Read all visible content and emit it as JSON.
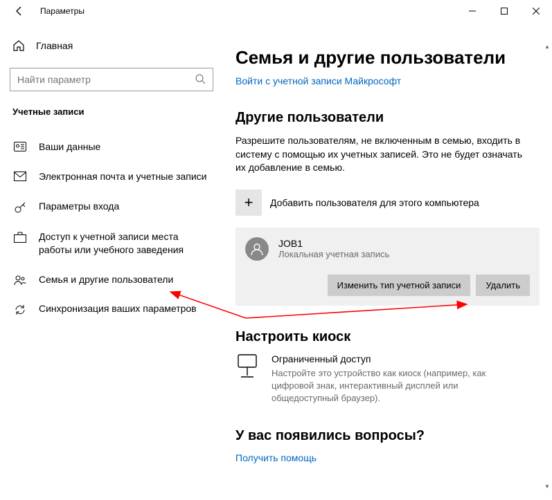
{
  "titlebar": {
    "title": "Параметры"
  },
  "sidebar": {
    "home": "Главная",
    "search_placeholder": "Найти параметр",
    "section": "Учетные записи",
    "items": [
      {
        "label": "Ваши данные"
      },
      {
        "label": "Электронная почта и учетные записи"
      },
      {
        "label": "Параметры входа"
      },
      {
        "label": "Доступ к учетной записи места работы или учебного заведения"
      },
      {
        "label": "Семья и другие пользователи"
      },
      {
        "label": "Синхронизация ваших параметров"
      }
    ]
  },
  "main": {
    "heading": "Семья и другие пользователи",
    "signin_link": "Войти с учетной записи Майкрософт",
    "other_users": {
      "title": "Другие пользователи",
      "desc": "Разрешите пользователям, не включенным в семью, входить в систему с помощью их учетных записей. Это не будет означать их добавление в семью.",
      "add_label": "Добавить пользователя для этого компьютера"
    },
    "user": {
      "name": "JOB1",
      "type": "Локальная учетная запись",
      "change_btn": "Изменить тип учетной записи",
      "delete_btn": "Удалить"
    },
    "kiosk": {
      "title": "Настроить киоск",
      "item_title": "Ограниченный доступ",
      "item_desc": "Настройте это устройство как киоск (например, как цифровой знак, интерактивный дисплей или общедоступный браузер)."
    },
    "help": {
      "title": "У вас появились вопросы?",
      "link": "Получить помощь"
    }
  }
}
